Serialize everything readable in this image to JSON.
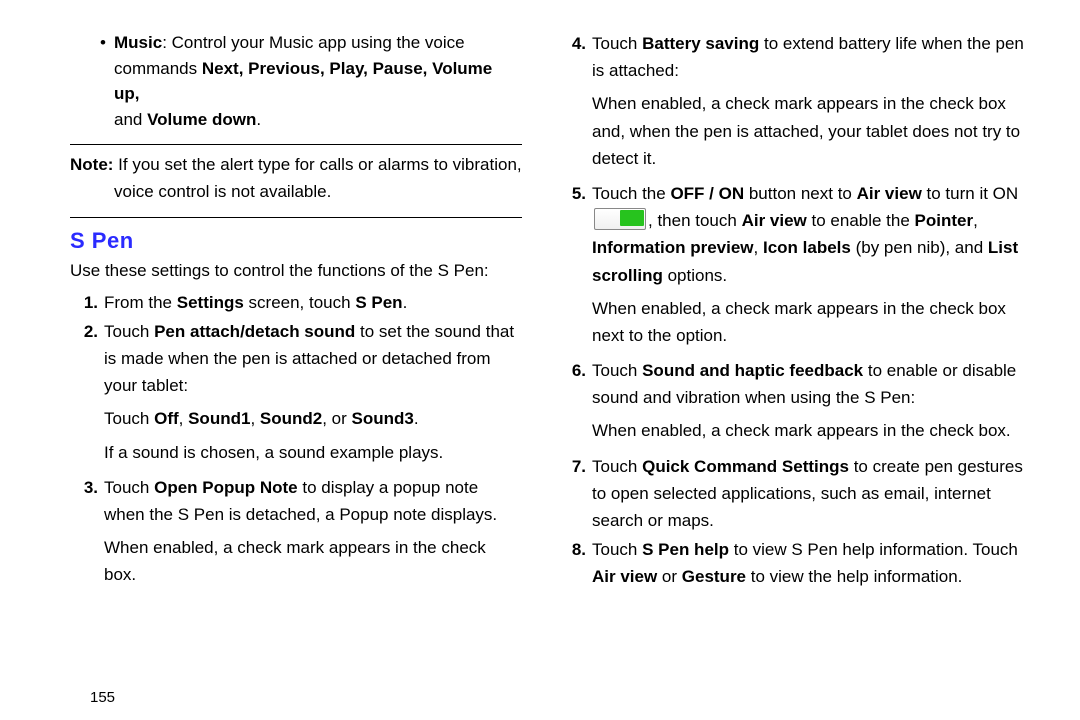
{
  "left": {
    "music_bullet_prefix": "Music",
    "music_bullet_text": ": Control your Music app using the voice commands ",
    "music_commands": "Next, Previous, Play, Pause, Volume up,",
    "music_tail_prefix": "and ",
    "music_tail_strong": "Volume down",
    "music_tail_suffix": ".",
    "note_label": "Note:",
    "note_text1": " If you set the alert type for calls or alarms to vibration,",
    "note_text2": "voice control is not available.",
    "heading": "S Pen",
    "intro": "Use these settings to control the functions of the S Pen:",
    "items": {
      "1": {
        "n": "1.",
        "pre": "From the ",
        "b1": "Settings",
        "mid": " screen, touch ",
        "b2": "S Pen",
        "post": "."
      },
      "2": {
        "n": "2.",
        "pre": "Touch ",
        "b1": "Pen attach/detach sound",
        "post": " to set the sound that is made when the pen is attached or detached from your tablet:",
        "sub_pre": "Touch ",
        "sub_b1": "Off",
        "sub_sep1": ", ",
        "sub_b2": "Sound1",
        "sub_sep2": ", ",
        "sub_b3": "Sound2",
        "sub_sep3": ", or ",
        "sub_b4": "Sound3",
        "sub_post": ".",
        "sub2": "If a sound is chosen, a sound example plays."
      },
      "3": {
        "n": "3.",
        "pre": "Touch ",
        "b1": "Open Popup Note",
        "post": " to display a popup note when the S Pen is detached, a Popup note displays.",
        "sub": "When enabled, a check mark appears in the check box."
      }
    },
    "page_number": "155"
  },
  "right": {
    "items": {
      "4": {
        "n": "4.",
        "pre": "Touch ",
        "b1": "Battery saving",
        "post": " to extend battery life when the pen is attached:",
        "sub": "When enabled, a check mark appears in the check box and, when the pen is attached, your tablet does not try to detect it."
      },
      "5": {
        "n": "5.",
        "pre": "Touch the ",
        "b1": "OFF / ON",
        "mid1": " button next to ",
        "b2": "Air view",
        "mid2": " to turn it ON ",
        "mid3": ", then touch ",
        "b3": "Air view",
        "mid4": " to enable the ",
        "b4": "Pointer",
        "mid5": ", ",
        "b5": "Information preview",
        "mid6": ", ",
        "b6": "Icon labels",
        "mid7": " (by pen nib), and ",
        "b7": "List scrolling",
        "post": " options.",
        "sub": "When enabled, a check mark appears in the check box next to the option."
      },
      "6": {
        "n": "6.",
        "pre": "Touch ",
        "b1": "Sound and haptic feedback",
        "post": " to enable or disable sound and vibration when using the S Pen:",
        "sub": "When enabled, a check mark appears in the check box."
      },
      "7": {
        "n": "7.",
        "pre": "Touch ",
        "b1": "Quick Command Settings",
        "post": " to create pen gestures to open selected applications, such as email, internet search or maps."
      },
      "8": {
        "n": "8.",
        "pre": "Touch ",
        "b1": "S Pen help",
        "mid1": " to view S Pen help information. Touch ",
        "b2": "Air view",
        "mid2": " or ",
        "b3": "Gesture",
        "post": " to view the help information."
      }
    }
  }
}
